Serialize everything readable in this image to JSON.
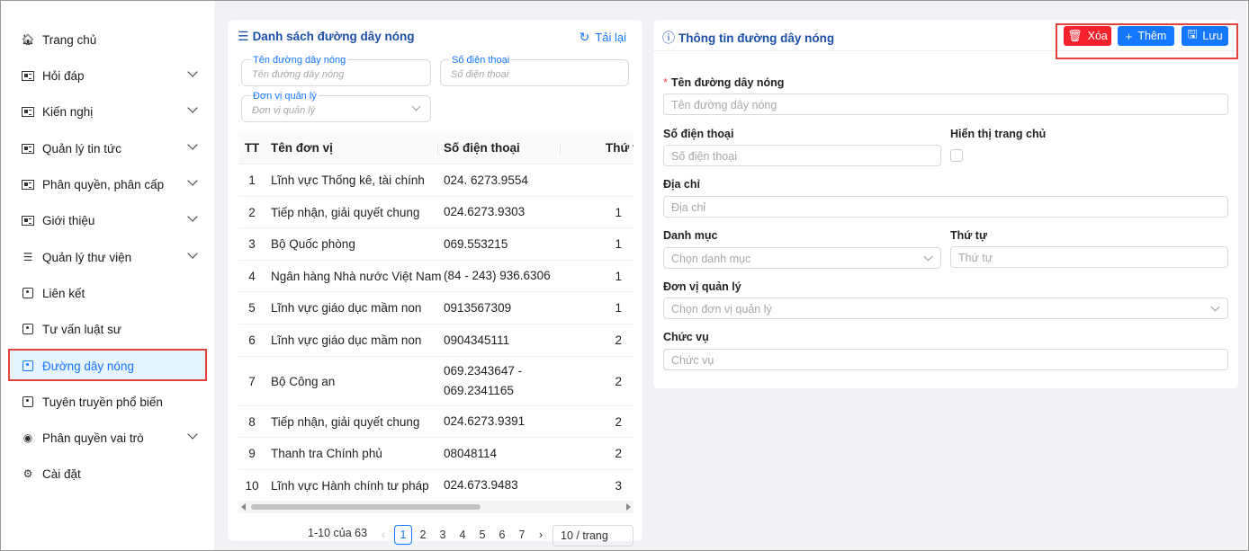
{
  "sidebar": {
    "items": [
      {
        "label": "Trang chủ",
        "icon": "home-icon"
      },
      {
        "label": "Hỏi đáp",
        "icon": "news-icon",
        "expandable": true
      },
      {
        "label": "Kiến nghị",
        "icon": "news-icon",
        "expandable": true
      },
      {
        "label": "Quản lý tin tức",
        "icon": "news-icon",
        "expandable": true
      },
      {
        "label": "Phân quyền, phân cấp",
        "icon": "news-icon",
        "expandable": true
      },
      {
        "label": "Giới thiệu",
        "icon": "news-icon",
        "expandable": true
      },
      {
        "label": "Quản lý thư viện",
        "icon": "menu-lines-icon",
        "expandable": true
      },
      {
        "label": "Liên kết",
        "icon": "contact-card-icon"
      },
      {
        "label": "Tư vấn luật sư",
        "icon": "contact-card-icon"
      },
      {
        "label": "Đường dây nóng",
        "icon": "contact-card-icon",
        "active": true
      },
      {
        "label": "Tuyên truyền phổ biến",
        "icon": "contact-card-icon"
      },
      {
        "label": "Phân quyền vai trò",
        "icon": "user-circle-icon",
        "expandable": true
      },
      {
        "label": "Cài đặt",
        "icon": "gears-icon"
      }
    ]
  },
  "list_panel": {
    "title": "Danh sách đường dây nóng",
    "reload_label": "Tải lại",
    "filters": {
      "name_label": "Tên đường dây nóng",
      "name_placeholder": "Tên đường dây nóng",
      "phone_label": "Số điện thoại",
      "phone_placeholder": "Số điện thoại",
      "unit_label": "Đơn vị quản lý",
      "unit_placeholder": "Đơn vị quản lý"
    },
    "table": {
      "headers": {
        "tt": "TT",
        "name": "Tên đơn vị",
        "phone": "Số điện thoại",
        "order": "Thứ t"
      },
      "rows": [
        {
          "tt": "1",
          "name": "Lĩnh vực Thống kê, tài chính",
          "phone": "024. 6273.9554",
          "order": ""
        },
        {
          "tt": "2",
          "name": "Tiếp nhận, giải quyết chung",
          "phone": "024.6273.9303",
          "order": "1"
        },
        {
          "tt": "3",
          "name": "Bộ Quốc phòng",
          "phone": "069.553215",
          "order": "1"
        },
        {
          "tt": "4",
          "name": "Ngân hàng Nhà nước Việt Nam",
          "phone": "(84 - 243) 936.6306",
          "order": "1"
        },
        {
          "tt": "5",
          "name": "Lĩnh vực giáo dục mầm non",
          "phone": "0913567309",
          "order": "1"
        },
        {
          "tt": "6",
          "name": "Lĩnh vực giáo dục mầm non",
          "phone": "0904345111",
          "order": "2"
        },
        {
          "tt": "7",
          "name": "Bộ Công an",
          "phone": "069.2343647 -",
          "phone2": "069.2341165",
          "order": "2"
        },
        {
          "tt": "8",
          "name": "Tiếp nhận, giải quyết chung",
          "phone": "024.6273.9391",
          "order": "2"
        },
        {
          "tt": "9",
          "name": "Thanh tra Chính phủ",
          "phone": "08048114",
          "order": "2"
        },
        {
          "tt": "10",
          "name": "Lĩnh vực Hành chính tư pháp",
          "phone": "024.673.9483",
          "order": "3"
        }
      ]
    },
    "pagination": {
      "summary": "1-10 của 63",
      "pages": [
        "1",
        "2",
        "3",
        "4",
        "5",
        "6",
        "7"
      ],
      "current": "1",
      "page_size": "10 / trang"
    }
  },
  "detail_panel": {
    "title": "Thông tin đường dây nóng",
    "buttons": {
      "delete": "Xóa",
      "add": "Thêm",
      "save": "Lưu"
    },
    "fields": {
      "name_label": "Tên đường dây nóng",
      "name_placeholder": "Tên đường dây nóng",
      "phone_label": "Số điện thoại",
      "phone_placeholder": "Số điện thoại",
      "show_home_label": "Hiển thị trang chủ",
      "address_label": "Địa chỉ",
      "address_placeholder": "Địa chỉ",
      "category_label": "Danh mục",
      "category_placeholder": "Chọn danh mục",
      "order_label": "Thứ tự",
      "order_placeholder": "Thứ tự",
      "unit_label": "Đơn vị quản lý",
      "unit_placeholder": "Chọn đơn vị quản lý",
      "position_label": "Chức vụ",
      "position_placeholder": "Chức vụ"
    }
  },
  "colors": {
    "primary": "#1677ff",
    "danger": "#f5222d",
    "highlight": "#e0443d",
    "title": "#1b4fa8"
  }
}
